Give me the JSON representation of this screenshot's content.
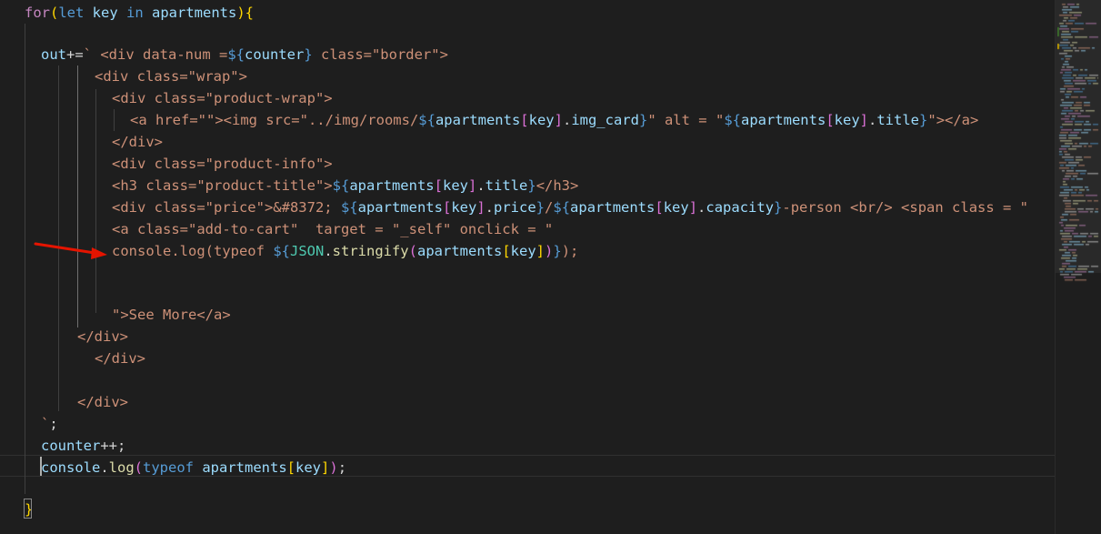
{
  "editor": {
    "language": "javascript",
    "lines": [
      {
        "tokens": [
          [
            "for",
            "k"
          ],
          [
            "(",
            "b"
          ],
          [
            "let ",
            "s"
          ],
          [
            "key ",
            "v"
          ],
          [
            "in ",
            "s"
          ],
          [
            "apartments",
            "v"
          ],
          [
            ")",
            "b"
          ],
          [
            "{",
            "b"
          ]
        ]
      },
      {
        "tokens": []
      },
      {
        "tokens": [
          [
            "out",
            "v"
          ],
          [
            "+=",
            "d"
          ],
          [
            "` <div data-num =",
            "st"
          ],
          [
            "${",
            "s"
          ],
          [
            "counter",
            "v"
          ],
          [
            "}",
            "s"
          ],
          [
            " class=\"border\">",
            "st"
          ]
        ]
      },
      {
        "tokens": [
          [
            "<div class=\"wrap\">",
            "st"
          ]
        ]
      },
      {
        "tokens": [
          [
            "<div class=\"product-wrap\">",
            "st"
          ]
        ]
      },
      {
        "tokens": [
          [
            "<a href=\"\"><img src=\"../img/rooms/",
            "st"
          ],
          [
            "${",
            "s"
          ],
          [
            "apartments",
            "v"
          ],
          [
            "[",
            "p"
          ],
          [
            "key",
            "v"
          ],
          [
            "]",
            "p"
          ],
          [
            ".",
            "d"
          ],
          [
            "img_card",
            "v"
          ],
          [
            "}",
            "s"
          ],
          [
            "\" alt = \"",
            "st"
          ],
          [
            "${",
            "s"
          ],
          [
            "apartments",
            "v"
          ],
          [
            "[",
            "p"
          ],
          [
            "key",
            "v"
          ],
          [
            "]",
            "p"
          ],
          [
            ".",
            "d"
          ],
          [
            "title",
            "v"
          ],
          [
            "}",
            "s"
          ],
          [
            "\"></a>",
            "st"
          ]
        ]
      },
      {
        "tokens": [
          [
            "</div>",
            "st"
          ]
        ]
      },
      {
        "tokens": [
          [
            "<div class=\"product-info\">",
            "st"
          ]
        ]
      },
      {
        "tokens": [
          [
            "<h3 class=\"product-title\">",
            "st"
          ],
          [
            "${",
            "s"
          ],
          [
            "apartments",
            "v"
          ],
          [
            "[",
            "p"
          ],
          [
            "key",
            "v"
          ],
          [
            "]",
            "p"
          ],
          [
            ".",
            "d"
          ],
          [
            "title",
            "v"
          ],
          [
            "}",
            "s"
          ],
          [
            "</h3>",
            "st"
          ]
        ]
      },
      {
        "tokens": [
          [
            "<div class=\"price\">&#8372; ",
            "st"
          ],
          [
            "${",
            "s"
          ],
          [
            "apartments",
            "v"
          ],
          [
            "[",
            "p"
          ],
          [
            "key",
            "v"
          ],
          [
            "]",
            "p"
          ],
          [
            ".",
            "d"
          ],
          [
            "price",
            "v"
          ],
          [
            "}",
            "s"
          ],
          [
            "/",
            "st"
          ],
          [
            "${",
            "s"
          ],
          [
            "apartments",
            "v"
          ],
          [
            "[",
            "p"
          ],
          [
            "key",
            "v"
          ],
          [
            "]",
            "p"
          ],
          [
            ".",
            "d"
          ],
          [
            "capacity",
            "v"
          ],
          [
            "}",
            "s"
          ],
          [
            "-person <br/> <span class = \"",
            "st"
          ]
        ]
      },
      {
        "tokens": [
          [
            "<a class=\"add-to-cart\"  target = \"_self\" onclick = \"",
            "st"
          ]
        ]
      },
      {
        "tokens": [
          [
            "console.log(typeof ",
            "st"
          ],
          [
            "${",
            "s"
          ],
          [
            "JSON",
            "c"
          ],
          [
            ".",
            "d"
          ],
          [
            "stringify",
            "f"
          ],
          [
            "(",
            "p"
          ],
          [
            "apartments",
            "v"
          ],
          [
            "[",
            "b"
          ],
          [
            "key",
            "v"
          ],
          [
            "]",
            "b"
          ],
          [
            ")",
            "p"
          ],
          [
            "}",
            "s"
          ],
          [
            ");",
            "st"
          ]
        ]
      },
      {
        "tokens": []
      },
      {
        "tokens": []
      },
      {
        "tokens": [
          [
            "\">See More</a>",
            "st"
          ]
        ]
      },
      {
        "tokens": [
          [
            "</div>",
            "st"
          ]
        ]
      },
      {
        "tokens": [
          [
            "</div>",
            "st"
          ]
        ]
      },
      {
        "tokens": []
      },
      {
        "tokens": [
          [
            "</div>",
            "st"
          ]
        ]
      },
      {
        "tokens": [
          [
            "`",
            "st"
          ],
          [
            ";",
            "d"
          ]
        ]
      },
      {
        "tokens": [
          [
            "counter",
            "v"
          ],
          [
            "++;",
            "d"
          ]
        ]
      },
      {
        "tokens": [
          [
            "console",
            "v"
          ],
          [
            ".",
            "d"
          ],
          [
            "log",
            "f"
          ],
          [
            "(",
            "p"
          ],
          [
            "typeof ",
            "s"
          ],
          [
            "apartments",
            "v"
          ],
          [
            "[",
            "b"
          ],
          [
            "key",
            "v"
          ],
          [
            "]",
            "b"
          ],
          [
            ")",
            "p"
          ],
          [
            ";",
            "d"
          ]
        ]
      },
      {
        "tokens": []
      },
      {
        "tokens": [
          [
            "}",
            "b"
          ]
        ]
      }
    ],
    "annotation": {
      "type": "red-arrow",
      "color": "#e51400",
      "points_to_line": 12
    },
    "colors": {
      "background": "#1e1e1e",
      "keyword": "#c586c0",
      "storage": "#569cd6",
      "variable": "#9cdcfe",
      "string": "#ce9178",
      "function": "#dcdcaa",
      "class": "#4ec9b0",
      "bracket": "#ffd700"
    }
  }
}
